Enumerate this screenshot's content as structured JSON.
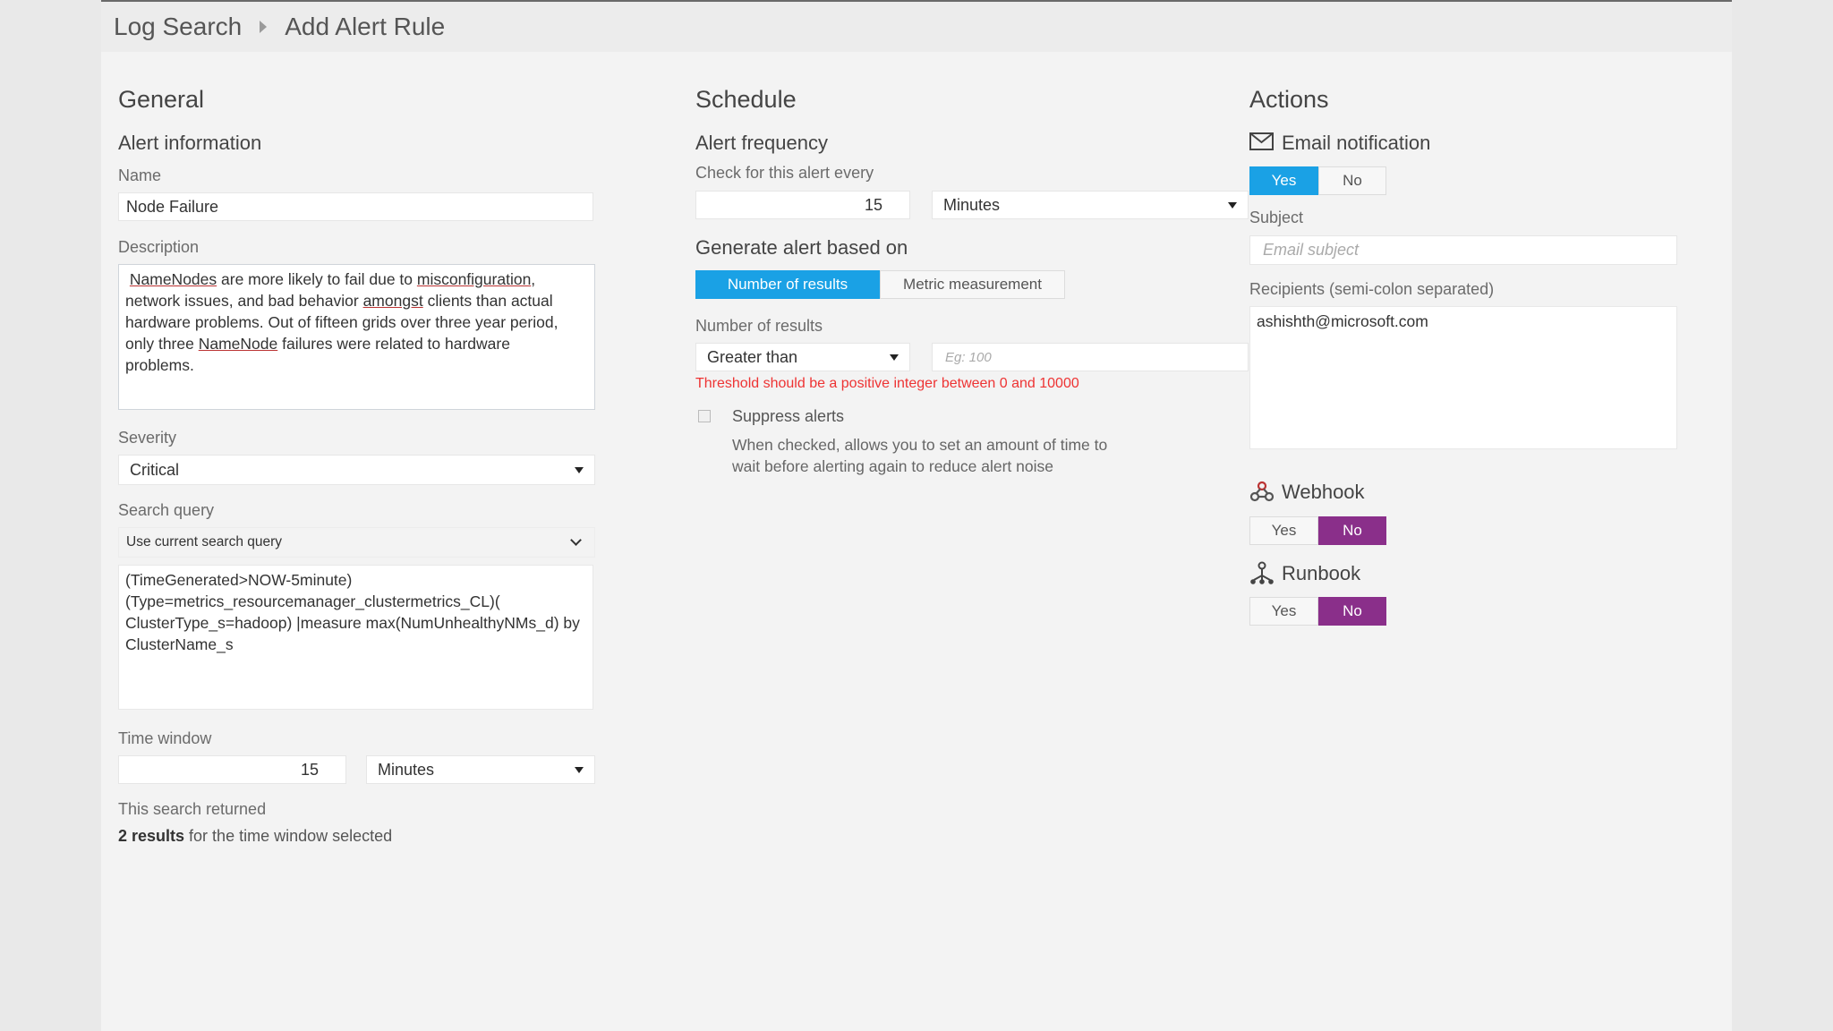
{
  "breadcrumb": {
    "parent": "Log Search",
    "current": "Add Alert Rule"
  },
  "general": {
    "title": "General",
    "section": "Alert information",
    "name_label": "Name",
    "name_value": "Node Failure",
    "description_label": "Description",
    "description_parts": [
      " ",
      "NameNodes",
      " are more likely to fail due to ",
      "misconfiguration",
      ",\nnetwork issues, and bad behavior ",
      "amongst",
      " clients than actual\nhardware problems. Out of fifteen grids over three year period,\nonly three ",
      "NameNode",
      " failures were related to hardware\nproblems."
    ],
    "severity_label": "Severity",
    "severity_value": "Critical",
    "search_query_label": "Search query",
    "search_query_select": "Use current search query",
    "search_query_text": "(TimeGenerated>NOW-5minute)\n(Type=metrics_resourcemanager_clustermetrics_CL)(\nClusterType_s=hadoop) |measure max(NumUnhealthyNMs_d) by\nClusterName_s",
    "time_window_label": "Time window",
    "time_window_value": "15",
    "time_window_unit": "Minutes",
    "search_returned_label": "This search returned",
    "results_bold": "2 results",
    "results_rest": " for the time window selected"
  },
  "schedule": {
    "title": "Schedule",
    "frequency_title": "Alert frequency",
    "check_label": "Check for this alert every",
    "check_value": "15",
    "check_unit": "Minutes",
    "generate_title": "Generate alert based on",
    "mode_options": [
      "Number of results",
      "Metric measurement"
    ],
    "num_results_label": "Number of results",
    "operator": "Greater than",
    "threshold_placeholder": "Eg: 100",
    "threshold_error": "Threshold should be a positive integer between 0 and 10000",
    "suppress_label": "Suppress alerts",
    "suppress_help": "When checked, allows you to set an amount of time to\nwait before alerting again to reduce alert noise"
  },
  "actions": {
    "title": "Actions",
    "email_title": "Email notification",
    "email_yes": "Yes",
    "email_no": "No",
    "subject_label": "Subject",
    "subject_placeholder": "Email subject",
    "recipients_label": "Recipients (semi-colon separated)",
    "recipients_value": "ashishth@microsoft.com",
    "webhook_title": "Webhook",
    "webhook_yes": "Yes",
    "webhook_no": "No",
    "runbook_title": "Runbook",
    "runbook_yes": "Yes",
    "runbook_no": "No"
  },
  "colors": {
    "accent_blue": "#1aa1e5",
    "accent_purple": "#8a2f8a",
    "error": "#e33"
  }
}
